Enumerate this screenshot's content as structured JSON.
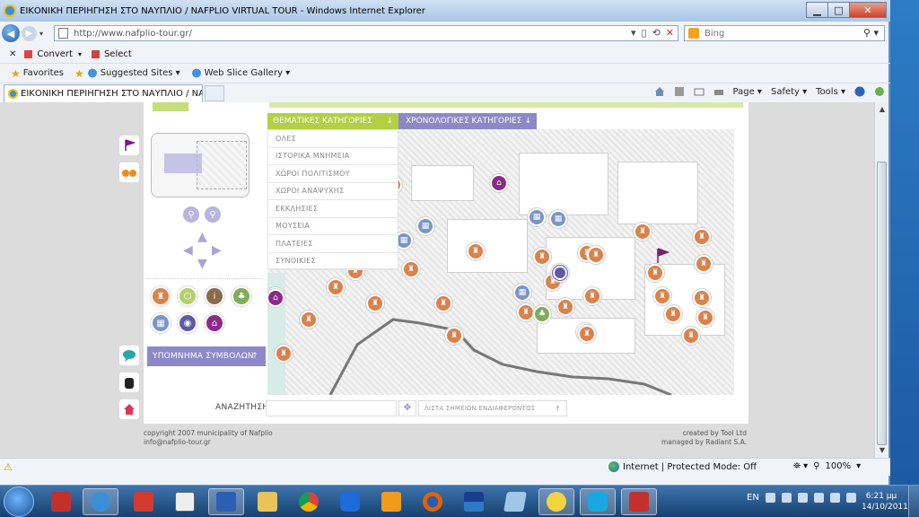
{
  "window": {
    "title": "ΕΙΚΟΝΙΚΗ ΠΕΡΙΗΓΗΣΗ ΣΤΟ ΝΑΥΠΛΙΟ / NAFPLIO VIRTUAL TOUR - Windows Internet Explorer",
    "minimize": "▁",
    "maximize": "□",
    "close": "✕"
  },
  "address": {
    "url": "http://www.nafplio-tour.gr/",
    "search_placeholder": "Bing"
  },
  "convert_bar": {
    "close": "✕",
    "convert": "Convert",
    "select": "Select"
  },
  "favorites_bar": {
    "favorites": "Favorites",
    "suggested_sites": "Suggested Sites ▾",
    "web_slice_gallery": "Web Slice Gallery ▾"
  },
  "tab": {
    "title": "ΕΙΚΟΝΙΚΗ ΠΕΡΙΗΓΗΣΗ ΣΤΟ ΝΑΥΠΛΙΟ / NAFPLIO..."
  },
  "command_bar": {
    "page": "Page ▾",
    "safety": "Safety ▾",
    "tools": "Tools ▾"
  },
  "site": {
    "thematic_categories": "ΘΕΜΑΤΙΚΕΣ ΚΑΤΗΓΟΡΙΕΣ",
    "chronological_categories": "ΧΡΟΝΟΛΟΓΙΚΕΣ ΚΑΤΗΓΟΡΙΕΣ",
    "categories": [
      "ΟΛΕΣ",
      "ΙΣΤΟΡΙΚΑ ΜΝΗΜΕΙΑ",
      "ΧΩΡΟΙ ΠΟΛΙΤΙΣΜΟΥ",
      "ΧΩΡΟΙ ΑΝΑΨΥΧΗΣ",
      "ΕΚΚΛΗΣΙΕΣ",
      "ΜΟΥΣΕΙΑ",
      "ΠΛΑΤΕΙΕΣ",
      "ΣΥΝΟΙΚΙΕΣ"
    ],
    "legend": "ΥΠΟΜΝΗΜΑ ΣΥΜΒΟΛΩΝ",
    "search_label": "ΑΝΑΖΗΤΗΣΗ",
    "search_value": "",
    "poi_list": "ΛΙΣΤΑ ΣΗΜΕΙΩΝ ΕΝΔΙΑΦΕΡΟΝΤΟΣ",
    "down_arrow": "↓",
    "up_arrow": "↑",
    "footer_left": [
      "copyright 2007 municipality of Nafplio",
      "info@nafplio-tour.gr"
    ],
    "footer_right": [
      "created by Tool Ltd",
      "managed by Radiant S.A."
    ]
  },
  "status": {
    "zone": "Internet | Protected Mode: Off",
    "zoom": "100%"
  },
  "taskbar": {
    "language": "EN",
    "time": "6:21 μμ",
    "date": "14/10/2011"
  },
  "colors": {
    "green_accent": "#b3cf43",
    "purple_accent": "#8d89c9",
    "orange_pin": "#d9824c",
    "blue_pin": "#7b95c7"
  }
}
